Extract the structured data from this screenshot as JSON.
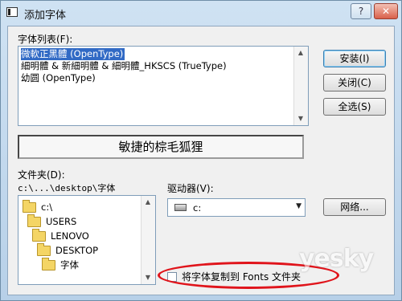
{
  "window": {
    "title": "添加字体",
    "help_button": "?",
    "close_button": "✕"
  },
  "font_list": {
    "label": "字体列表(F):",
    "items": [
      {
        "label": "微軟正黑體 (OpenType)",
        "selected": true
      },
      {
        "label": "細明體 & 新細明體 & 細明體_HKSCS (TrueType)",
        "selected": false
      },
      {
        "label": "幼圆 (OpenType)",
        "selected": false
      }
    ]
  },
  "buttons": {
    "install": "安装(I)",
    "close": "关闭(C)",
    "select_all": "全选(S)",
    "network": "网络..."
  },
  "preview": {
    "text": "敏捷的棕毛狐狸"
  },
  "folders": {
    "label": "文件夹(D):",
    "current_path": "c:\\...\\desktop\\字体",
    "items": [
      "c:\\",
      "USERS",
      "LENOVO",
      "DESKTOP",
      "字体"
    ]
  },
  "drives": {
    "label": "驱动器(V):",
    "selected": "c:"
  },
  "copy_option": {
    "label": "将字体复制到 Fonts 文件夹",
    "checked": false
  },
  "watermark": "yesky",
  "colors": {
    "selection": "#316ac5",
    "annotation": "#e0141b"
  }
}
